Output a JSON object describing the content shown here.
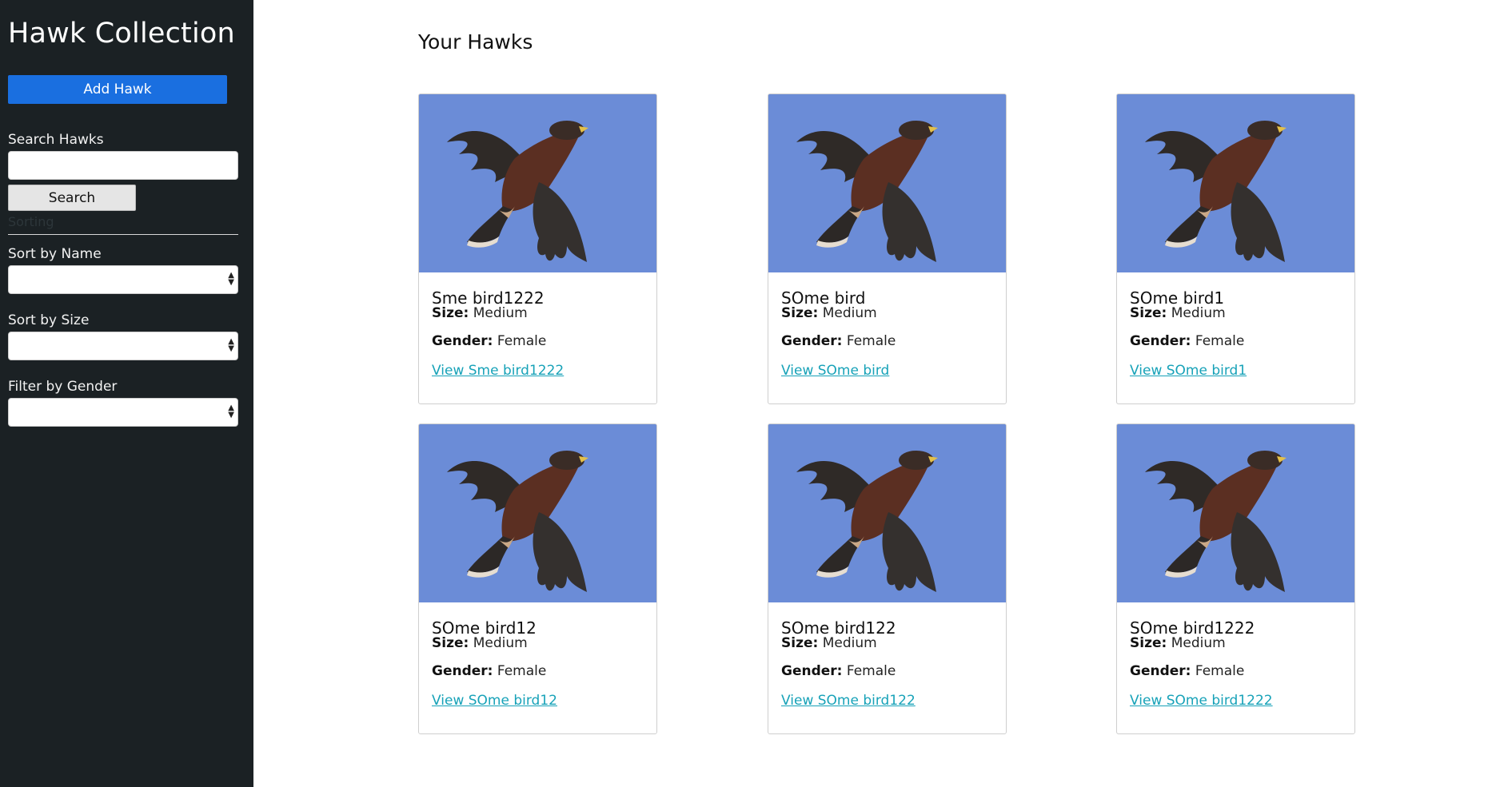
{
  "sidebar": {
    "title": "Hawk Collection",
    "add_button": "Add Hawk",
    "search_label": "Search Hawks",
    "search_placeholder": "",
    "search_value": "",
    "search_button": "Search",
    "sorting_heading": "Sorting",
    "sort_name_label": "Sort by Name",
    "sort_name_value": "",
    "sort_size_label": "Sort by Size",
    "sort_size_value": "",
    "filter_gender_label": "Filter by Gender",
    "filter_gender_value": ""
  },
  "main": {
    "title": "Your Hawks",
    "hawks": [
      {
        "name": "Sme bird1222",
        "size_label": "Size:",
        "size": "Medium",
        "gender_label": "Gender:",
        "gender": "Female",
        "link": "View Sme bird1222"
      },
      {
        "name": "SOme bird",
        "size_label": "Size:",
        "size": "Medium",
        "gender_label": "Gender:",
        "gender": "Female",
        "link": "View SOme bird"
      },
      {
        "name": "SOme bird1",
        "size_label": "Size:",
        "size": "Medium",
        "gender_label": "Gender:",
        "gender": "Female",
        "link": "View SOme bird1"
      },
      {
        "name": "SOme bird12",
        "size_label": "Size:",
        "size": "Medium",
        "gender_label": "Gender:",
        "gender": "Female",
        "link": "View SOme bird12"
      },
      {
        "name": "SOme bird122",
        "size_label": "Size:",
        "size": "Medium",
        "gender_label": "Gender:",
        "gender": "Female",
        "link": "View SOme bird122"
      },
      {
        "name": "SOme bird1222",
        "size_label": "Size:",
        "size": "Medium",
        "gender_label": "Gender:",
        "gender": "Female",
        "link": "View SOme bird1222"
      }
    ]
  },
  "colors": {
    "sidebar_bg": "#1b2124",
    "primary": "#1a6fe0",
    "link": "#17a2b8",
    "sky": "#6a8bd6"
  }
}
